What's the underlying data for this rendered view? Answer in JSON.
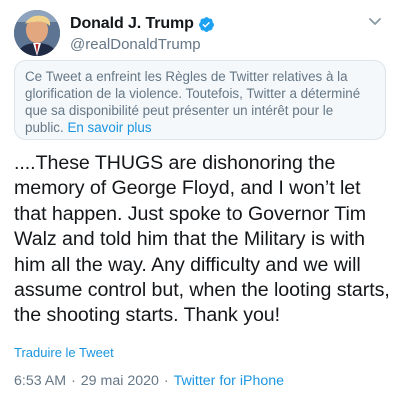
{
  "author": {
    "display_name": "Donald J. Trump",
    "handle": "@realDonaldTrump",
    "verified": true,
    "verified_color": "#1da1f2"
  },
  "notice": {
    "text": "Ce Tweet a enfreint les Règles de Twitter relatives à la glorification de la violence. Toutefois, Twitter a déterminé que sa disponibilité peut présenter un intérêt pour le public.",
    "link_label": "En savoir plus"
  },
  "tweet": {
    "text": "....These THUGS are dishonoring the memory of George Floyd, and I won’t let that happen. Just spoke to Governor Tim Walz and told him that the Military is with him all the way. Any difficulty and we will assume control but, when the looting starts, the shooting starts. Thank you!",
    "translate_label": "Traduire le Tweet"
  },
  "meta": {
    "time": "6:53 AM",
    "separator": "·",
    "date": "29 mai 2020",
    "source": "Twitter for iPhone"
  },
  "colors": {
    "link": "#1b95e0",
    "secondary_text": "#657786",
    "primary_text": "#14171a",
    "notice_background": "#f5f8fa"
  },
  "icons": {
    "more": "chevron-down-icon",
    "verified": "verified-badge-icon"
  }
}
